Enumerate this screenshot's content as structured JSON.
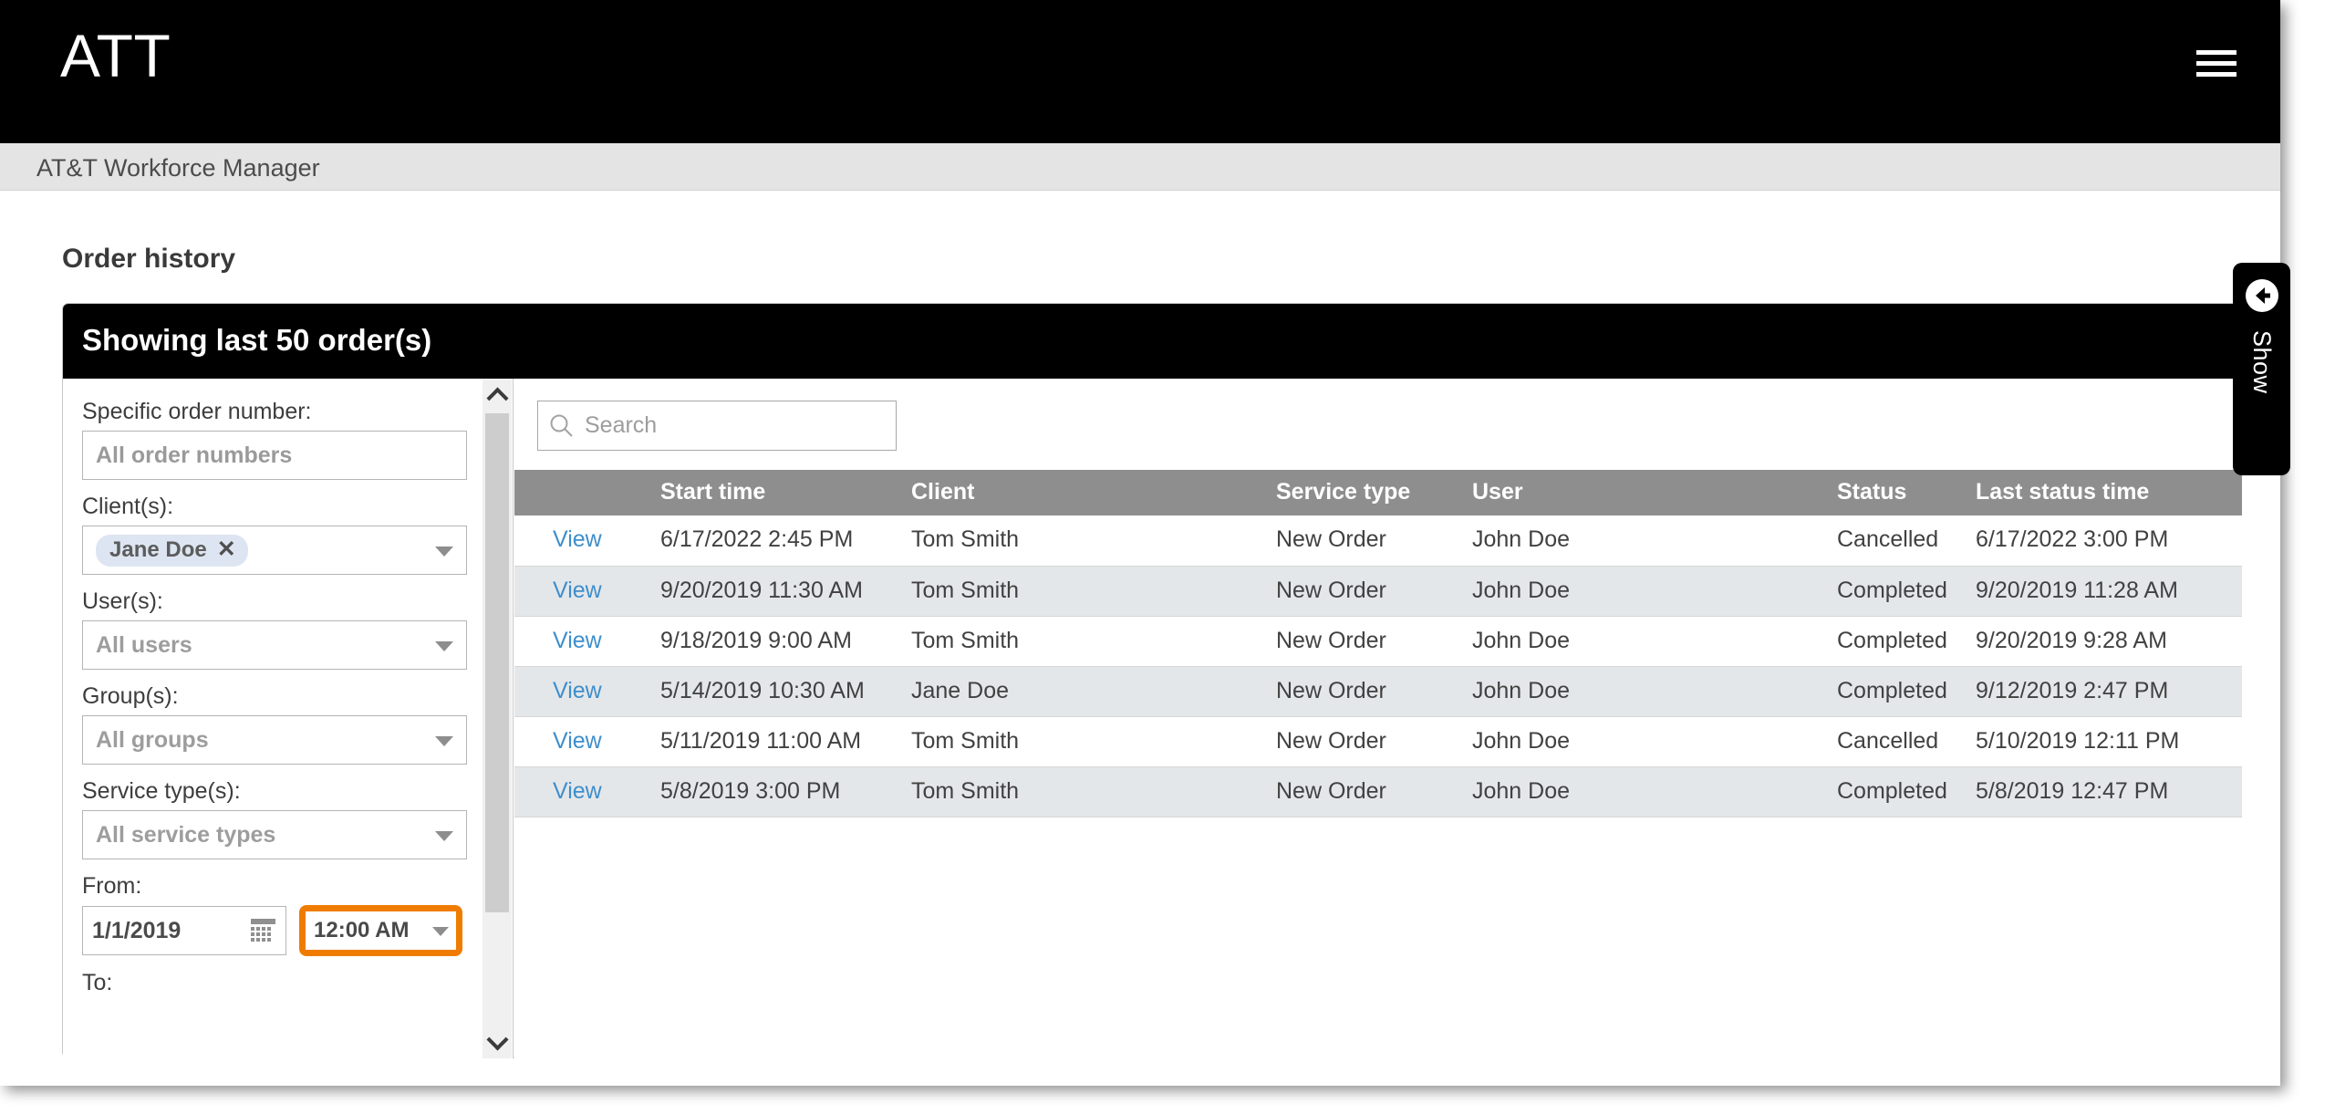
{
  "header": {
    "logo": "ATT",
    "menu_icon": "hamburger-menu-icon"
  },
  "subheader": {
    "app_name": "AT&T Workforce Manager"
  },
  "page": {
    "title": "Order history"
  },
  "card": {
    "header_title": "Showing last 50 order(s)"
  },
  "filters": {
    "order_number": {
      "label": "Specific order number:",
      "placeholder": "All order numbers",
      "value": ""
    },
    "clients": {
      "label": "Client(s):",
      "chips": [
        {
          "label": "Jane Doe",
          "remove": "✕"
        }
      ]
    },
    "users": {
      "label": "User(s):",
      "placeholder": "All users",
      "value": ""
    },
    "groups": {
      "label": "Group(s):",
      "placeholder": "All groups",
      "value": ""
    },
    "service_types": {
      "label": "Service type(s):",
      "placeholder": "All service types",
      "value": ""
    },
    "from": {
      "label": "From:",
      "date": "1/1/2019",
      "time": "12:00 AM",
      "highlight_color": "#ef7c00"
    },
    "to": {
      "label": "To:"
    }
  },
  "search": {
    "placeholder": "Search",
    "value": ""
  },
  "table": {
    "columns": [
      "",
      "Start time",
      "Client",
      "Service type",
      "User",
      "Status",
      "Last status time"
    ],
    "action_label": "View",
    "rows": [
      {
        "action": "View",
        "start_time": "6/17/2022 2:45 PM",
        "client": "Tom Smith",
        "service_type": "New Order",
        "user": "John Doe",
        "status": "Cancelled",
        "last_status_time": "6/17/2022 3:00 PM"
      },
      {
        "action": "View",
        "start_time": "9/20/2019 11:30 AM",
        "client": "Tom Smith",
        "service_type": "New Order",
        "user": "John Doe",
        "status": "Completed",
        "last_status_time": "9/20/2019 11:28 AM"
      },
      {
        "action": "View",
        "start_time": "9/18/2019 9:00 AM",
        "client": "Tom Smith",
        "service_type": "New Order",
        "user": "John Doe",
        "status": "Completed",
        "last_status_time": "9/20/2019 9:28 AM"
      },
      {
        "action": "View",
        "start_time": "5/14/2019 10:30 AM",
        "client": "Jane Doe",
        "service_type": "New Order",
        "user": "John Doe",
        "status": "Completed",
        "last_status_time": "9/12/2019 2:47 PM"
      },
      {
        "action": "View",
        "start_time": "5/11/2019 11:00 AM",
        "client": "Tom Smith",
        "service_type": "New Order",
        "user": "John Doe",
        "status": "Cancelled",
        "last_status_time": "5/10/2019 12:11 PM"
      },
      {
        "action": "View",
        "start_time": "5/8/2019 3:00 PM",
        "client": "Tom Smith",
        "service_type": "New Order",
        "user": "John Doe",
        "status": "Completed",
        "last_status_time": "5/8/2019 12:47 PM"
      }
    ]
  },
  "show_tab": {
    "label": "Show",
    "icon": "arrow-left-circle-icon"
  }
}
